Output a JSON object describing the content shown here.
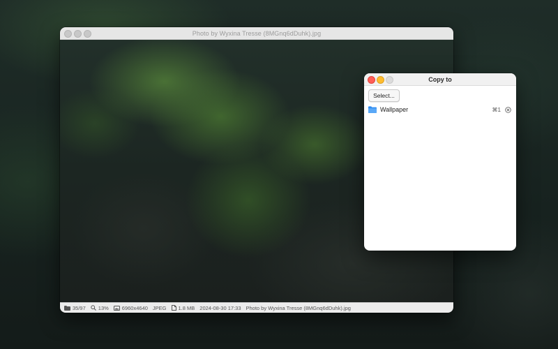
{
  "viewer": {
    "title": "Photo by Wyxina Tresse (8MGnq6dDuhk).jpg",
    "status": {
      "position": "35/97",
      "zoom": "13%",
      "dimensions": "6960x4640",
      "format": "JPEG",
      "file_size": "1.8 MB",
      "date": "2024-08-30 17:33",
      "filename": "Photo by Wyxina Tresse (8MGnq6dDuhk).jpg"
    }
  },
  "copy_panel": {
    "title": "Copy to",
    "select_label": "Select...",
    "destinations": [
      {
        "name": "Wallpaper",
        "shortcut": "⌘1",
        "icon": "folder-icon"
      }
    ]
  },
  "colors": {
    "close": "#ff5f57",
    "minimize": "#febc2e",
    "folder": "#2f8cf0"
  }
}
